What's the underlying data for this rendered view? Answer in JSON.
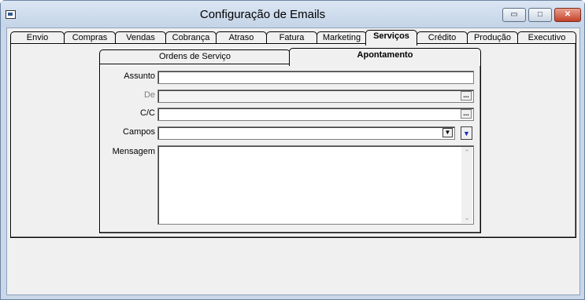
{
  "window": {
    "title": "Configuração de Emails",
    "minimize_glyph": "▭",
    "maximize_glyph": "□",
    "close_glyph": "✕"
  },
  "outer_tabs": [
    {
      "label": "Envio"
    },
    {
      "label": "Compras"
    },
    {
      "label": "Vendas"
    },
    {
      "label": "Cobrança"
    },
    {
      "label": "Atraso"
    },
    {
      "label": "Fatura"
    },
    {
      "label": "Marketing"
    },
    {
      "label": "Serviços",
      "active": true
    },
    {
      "label": "Crédito"
    },
    {
      "label": "Produção"
    },
    {
      "label": "Executivo"
    }
  ],
  "inner_tabs": [
    {
      "label": "Ordens de Serviço"
    },
    {
      "label": "Apontamento",
      "active": true
    }
  ],
  "form": {
    "assunto_label": "Assunto",
    "assunto_value": "",
    "de_label": "De",
    "de_value": "",
    "de_button": "...",
    "cc_label": "C/C",
    "cc_value": "",
    "cc_button": "...",
    "campos_label": "Campos",
    "campos_value": "",
    "campos_arrow": "▼",
    "campos_insert_glyph": "▼",
    "mensagem_label": "Mensagem",
    "mensagem_value": "",
    "scroll_up_glyph": "⌃",
    "scroll_down_glyph": "⌄"
  }
}
